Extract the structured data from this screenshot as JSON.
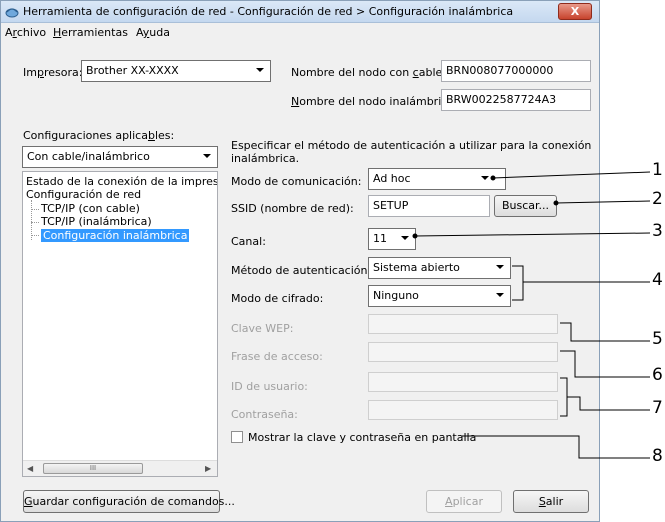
{
  "window": {
    "title": "Herramienta de configuración de red - Configuración de red > Configuración inalámbrica",
    "close_label": "X"
  },
  "menu": {
    "items": [
      {
        "label": "Archivo",
        "mn": "r",
        "pre": "A",
        "post": "chivo"
      },
      {
        "label": "Herramientas",
        "mn": "H",
        "pre": "",
        "post": "erramientas"
      },
      {
        "label": "Ayuda",
        "mn": "y",
        "pre": "A",
        "post": "uda"
      }
    ]
  },
  "printer": {
    "label_pre": "Im",
    "label_mn": "p",
    "label_post": "resora:",
    "value": "Brother XX-XXXX",
    "wired_node_label_pre": "Nombre del nodo con ",
    "wired_node_label_mn": "c",
    "wired_node_label_post": "able:",
    "wired_node_value": "BRN008077000000",
    "wireless_node_label_mn": "N",
    "wireless_node_label_post": "ombre del nodo inalámbrico:",
    "wireless_node_value": "BRW0022587724A3"
  },
  "configs": {
    "label_pre": "Configuraciones aplica",
    "label_mn": "b",
    "label_post": "les:",
    "value": "Con cable/inalámbrico"
  },
  "tree": {
    "items": [
      "Estado de la conexión de la impreso",
      "Configuración de red",
      "TCP/IP (con cable)",
      "TCP/IP (inalámbrica)",
      "Configuración inalámbrica"
    ],
    "scroll_thumb": "III"
  },
  "form": {
    "description": [
      "Especificar el método de autenticación a utilizar para la conexión",
      "inalámbrica."
    ],
    "comm_mode_label": "Modo de comunicación:",
    "comm_mode_value": "Ad hoc",
    "ssid_label": "SSID (nombre de red):",
    "ssid_value": "SETUP",
    "search_button": "Buscar...",
    "channel_label": "Canal:",
    "channel_value": "11",
    "auth_label": "Método de autenticación:",
    "auth_value": "Sistema abierto",
    "cipher_label": "Modo de cifrado:",
    "cipher_value": "Ninguno",
    "wep_label": "Clave WEP:",
    "passphrase_label": "Frase de acceso:",
    "userid_label": "ID de usuario:",
    "password_label": "Contraseña:",
    "show_key_label": "Mostrar la clave y contraseña en pantalla"
  },
  "buttons": {
    "save_mn": "G",
    "save_post": "uardar configuración de comandos...",
    "apply_mn": "A",
    "apply_post": "plicar",
    "exit_mn": "S",
    "exit_post": "alir"
  },
  "callouts": [
    "1",
    "2",
    "3",
    "4",
    "5",
    "6",
    "7",
    "8"
  ]
}
